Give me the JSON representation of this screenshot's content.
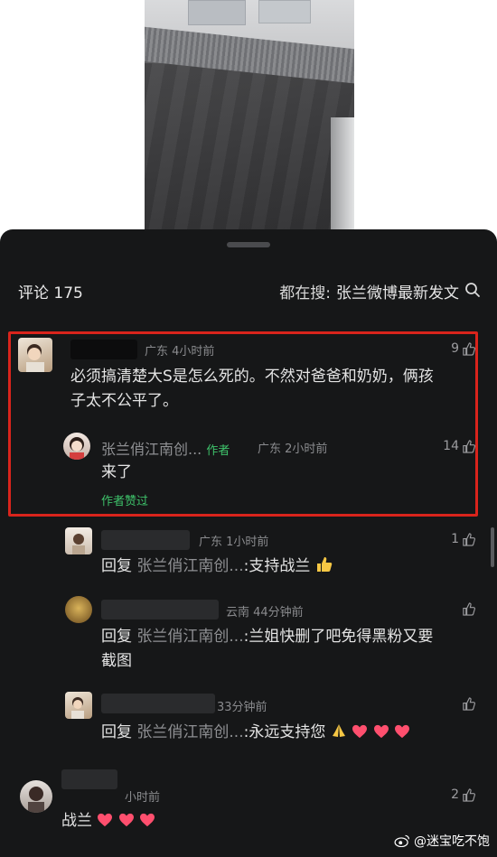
{
  "header": {
    "comments_label": "评论 175",
    "search_prefix": "都在搜:",
    "search_keyword": "张兰微博最新发文",
    "search_icon": "search-icon"
  },
  "comments": [
    {
      "meta": "广东 4小时前",
      "text_line1": "必须搞清楚大S是怎么死的。不然对爸爸和奶奶，俩孩",
      "text_line2": "子太不公平了。",
      "likes": "9",
      "highlighted": true,
      "reply": {
        "author": "张兰俏江南创...",
        "author_tag": "作者",
        "meta": "广东 2小时前",
        "text": "来了",
        "likes": "14",
        "liked_by_author": "作者赞过"
      }
    }
  ],
  "replies": [
    {
      "meta": "广东 1小时前",
      "prefix": "回复",
      "reply_to": "张兰俏江南创...",
      "text": ":支持战兰",
      "emoji": "thumbs-up-emoji",
      "likes": "1"
    },
    {
      "meta": "云南 44分钟前",
      "prefix": "回复",
      "reply_to": "张兰俏江南创...",
      "text_line1": ":兰姐快删了吧免得黑粉又要",
      "text_line2": "截图",
      "likes": ""
    },
    {
      "meta": "33分钟前",
      "prefix": "回复",
      "reply_to": "张兰俏江南创...",
      "text": ":永远支持您",
      "emoji": "pray-emoji",
      "hearts": 3,
      "likes": ""
    }
  ],
  "last_comment": {
    "meta": "小时前",
    "text": "战兰",
    "hearts": 3,
    "likes": "2"
  },
  "watermark": {
    "text": "@迷宝吃不饱",
    "icon": "weibo-logo-icon"
  },
  "colors": {
    "panel_bg": "#161718",
    "highlight_border": "#d9241c",
    "author_green": "#3ec26a",
    "heart_pink": "#ff4f6e"
  }
}
